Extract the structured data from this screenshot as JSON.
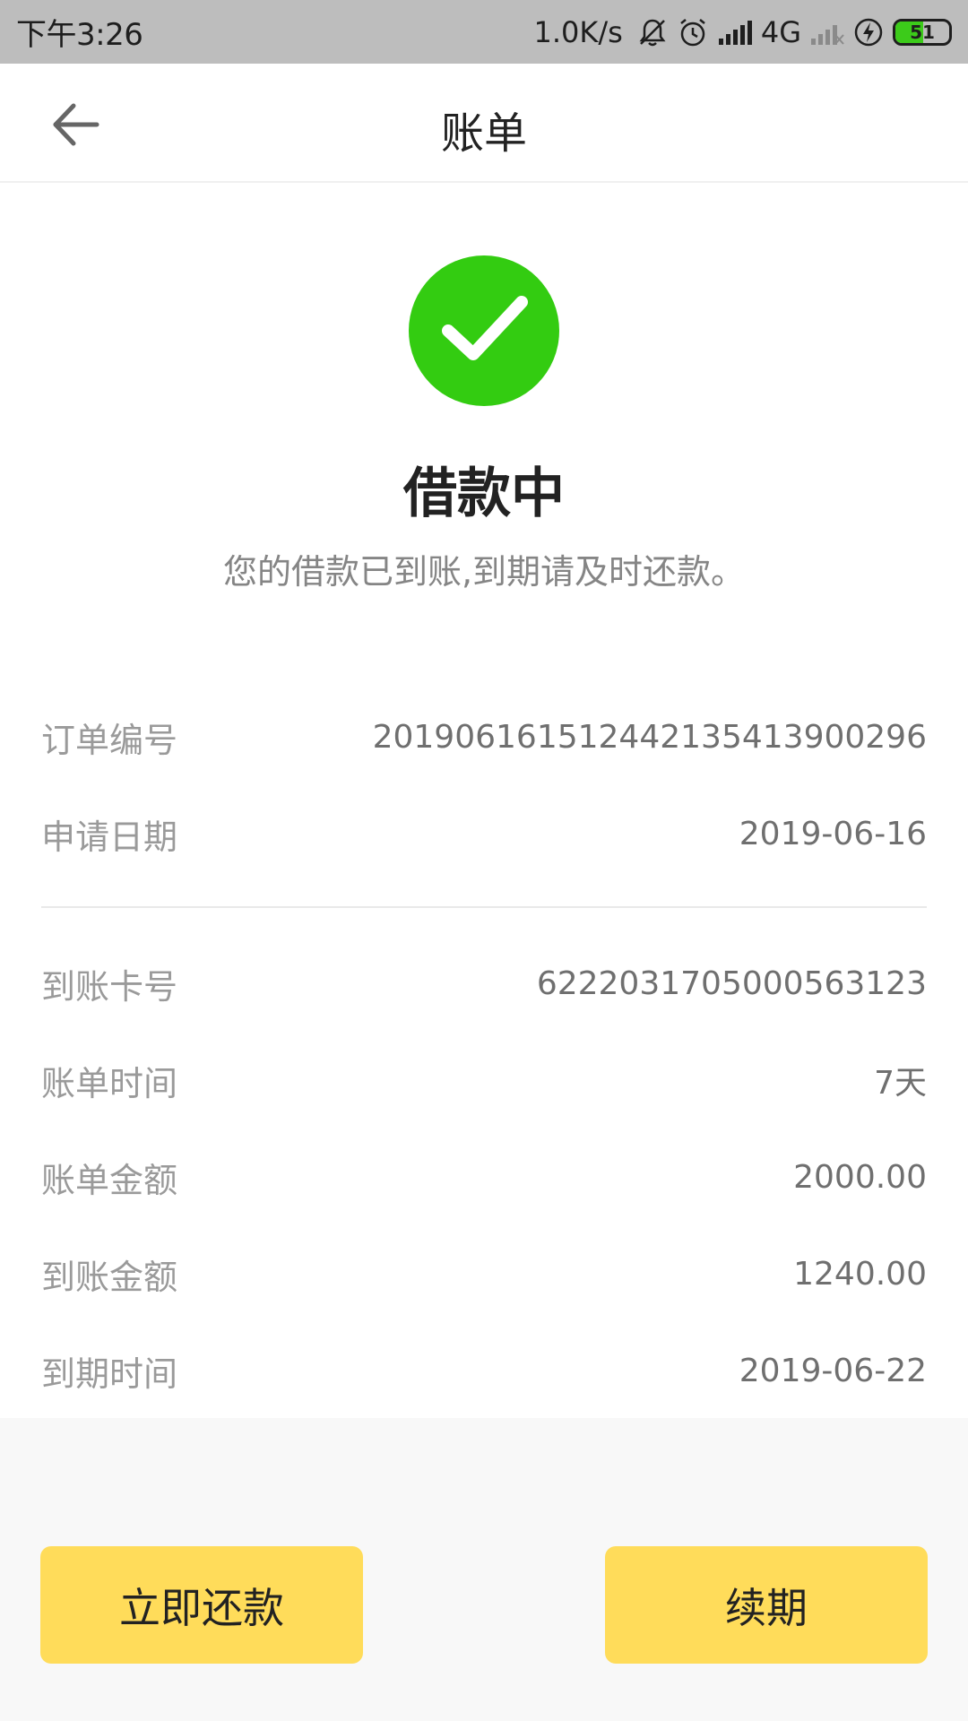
{
  "status_bar": {
    "time": "下午3:26",
    "speed": "1.0K/s",
    "network": "4G",
    "battery": "51"
  },
  "header": {
    "title": "账单"
  },
  "status": {
    "title": "借款中",
    "subtitle": "您的借款已到账,到期请及时还款。"
  },
  "details": {
    "group1": [
      {
        "label": "订单编号",
        "value": "201906161512442135413900296"
      },
      {
        "label": "申请日期",
        "value": "2019-06-16"
      }
    ],
    "group2": [
      {
        "label": "到账卡号",
        "value": "6222031705000563123"
      },
      {
        "label": "账单时间",
        "value": "7天"
      },
      {
        "label": "账单金额",
        "value": "2000.00"
      },
      {
        "label": "到账金额",
        "value": "1240.00"
      },
      {
        "label": "到期时间",
        "value": "2019-06-22"
      }
    ]
  },
  "buttons": {
    "repay_label": "立即还款",
    "renew_label": "续期"
  },
  "colors": {
    "accent_button": "#ffdc5a",
    "success_green": "#33cc11",
    "status_bar_bg": "#bdbdbd"
  }
}
